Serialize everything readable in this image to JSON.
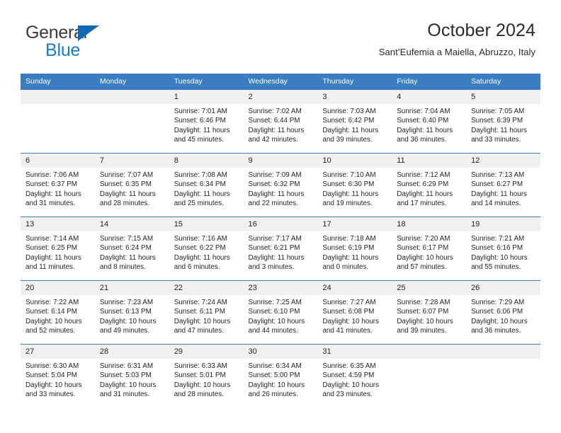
{
  "brand": {
    "name_top": "General",
    "name_bottom": "Blue",
    "accent_color": "#1a7dc4",
    "triangle_color": "#1268b3"
  },
  "header": {
    "title": "October 2024",
    "subtitle": "Sant’Eufemia a Maiella, Abruzzo, Italy"
  },
  "calendar": {
    "header_bg": "#3a7dc0",
    "daynum_bg": "#f0f0f0",
    "weekday_headers": [
      "Sunday",
      "Monday",
      "Tuesday",
      "Wednesday",
      "Thursday",
      "Friday",
      "Saturday"
    ],
    "labels": {
      "sunrise": "Sunrise:",
      "sunset": "Sunset:",
      "daylight": "Daylight:"
    },
    "weeks": [
      [
        {
          "day": "",
          "blank": true
        },
        {
          "day": "",
          "blank": true
        },
        {
          "day": "1",
          "sunrise": "Sunrise: 7:01 AM",
          "sunset": "Sunset: 6:46 PM",
          "daylight": "Daylight: 11 hours and 45 minutes."
        },
        {
          "day": "2",
          "sunrise": "Sunrise: 7:02 AM",
          "sunset": "Sunset: 6:44 PM",
          "daylight": "Daylight: 11 hours and 42 minutes."
        },
        {
          "day": "3",
          "sunrise": "Sunrise: 7:03 AM",
          "sunset": "Sunset: 6:42 PM",
          "daylight": "Daylight: 11 hours and 39 minutes."
        },
        {
          "day": "4",
          "sunrise": "Sunrise: 7:04 AM",
          "sunset": "Sunset: 6:40 PM",
          "daylight": "Daylight: 11 hours and 36 minutes."
        },
        {
          "day": "5",
          "sunrise": "Sunrise: 7:05 AM",
          "sunset": "Sunset: 6:39 PM",
          "daylight": "Daylight: 11 hours and 33 minutes."
        }
      ],
      [
        {
          "day": "6",
          "sunrise": "Sunrise: 7:06 AM",
          "sunset": "Sunset: 6:37 PM",
          "daylight": "Daylight: 11 hours and 31 minutes."
        },
        {
          "day": "7",
          "sunrise": "Sunrise: 7:07 AM",
          "sunset": "Sunset: 6:35 PM",
          "daylight": "Daylight: 11 hours and 28 minutes."
        },
        {
          "day": "8",
          "sunrise": "Sunrise: 7:08 AM",
          "sunset": "Sunset: 6:34 PM",
          "daylight": "Daylight: 11 hours and 25 minutes."
        },
        {
          "day": "9",
          "sunrise": "Sunrise: 7:09 AM",
          "sunset": "Sunset: 6:32 PM",
          "daylight": "Daylight: 11 hours and 22 minutes."
        },
        {
          "day": "10",
          "sunrise": "Sunrise: 7:10 AM",
          "sunset": "Sunset: 6:30 PM",
          "daylight": "Daylight: 11 hours and 19 minutes."
        },
        {
          "day": "11",
          "sunrise": "Sunrise: 7:12 AM",
          "sunset": "Sunset: 6:29 PM",
          "daylight": "Daylight: 11 hours and 17 minutes."
        },
        {
          "day": "12",
          "sunrise": "Sunrise: 7:13 AM",
          "sunset": "Sunset: 6:27 PM",
          "daylight": "Daylight: 11 hours and 14 minutes."
        }
      ],
      [
        {
          "day": "13",
          "sunrise": "Sunrise: 7:14 AM",
          "sunset": "Sunset: 6:25 PM",
          "daylight": "Daylight: 11 hours and 11 minutes."
        },
        {
          "day": "14",
          "sunrise": "Sunrise: 7:15 AM",
          "sunset": "Sunset: 6:24 PM",
          "daylight": "Daylight: 11 hours and 8 minutes."
        },
        {
          "day": "15",
          "sunrise": "Sunrise: 7:16 AM",
          "sunset": "Sunset: 6:22 PM",
          "daylight": "Daylight: 11 hours and 6 minutes."
        },
        {
          "day": "16",
          "sunrise": "Sunrise: 7:17 AM",
          "sunset": "Sunset: 6:21 PM",
          "daylight": "Daylight: 11 hours and 3 minutes."
        },
        {
          "day": "17",
          "sunrise": "Sunrise: 7:18 AM",
          "sunset": "Sunset: 6:19 PM",
          "daylight": "Daylight: 11 hours and 0 minutes."
        },
        {
          "day": "18",
          "sunrise": "Sunrise: 7:20 AM",
          "sunset": "Sunset: 6:17 PM",
          "daylight": "Daylight: 10 hours and 57 minutes."
        },
        {
          "day": "19",
          "sunrise": "Sunrise: 7:21 AM",
          "sunset": "Sunset: 6:16 PM",
          "daylight": "Daylight: 10 hours and 55 minutes."
        }
      ],
      [
        {
          "day": "20",
          "sunrise": "Sunrise: 7:22 AM",
          "sunset": "Sunset: 6:14 PM",
          "daylight": "Daylight: 10 hours and 52 minutes."
        },
        {
          "day": "21",
          "sunrise": "Sunrise: 7:23 AM",
          "sunset": "Sunset: 6:13 PM",
          "daylight": "Daylight: 10 hours and 49 minutes."
        },
        {
          "day": "22",
          "sunrise": "Sunrise: 7:24 AM",
          "sunset": "Sunset: 6:11 PM",
          "daylight": "Daylight: 10 hours and 47 minutes."
        },
        {
          "day": "23",
          "sunrise": "Sunrise: 7:25 AM",
          "sunset": "Sunset: 6:10 PM",
          "daylight": "Daylight: 10 hours and 44 minutes."
        },
        {
          "day": "24",
          "sunrise": "Sunrise: 7:27 AM",
          "sunset": "Sunset: 6:08 PM",
          "daylight": "Daylight: 10 hours and 41 minutes."
        },
        {
          "day": "25",
          "sunrise": "Sunrise: 7:28 AM",
          "sunset": "Sunset: 6:07 PM",
          "daylight": "Daylight: 10 hours and 39 minutes."
        },
        {
          "day": "26",
          "sunrise": "Sunrise: 7:29 AM",
          "sunset": "Sunset: 6:06 PM",
          "daylight": "Daylight: 10 hours and 36 minutes."
        }
      ],
      [
        {
          "day": "27",
          "sunrise": "Sunrise: 6:30 AM",
          "sunset": "Sunset: 5:04 PM",
          "daylight": "Daylight: 10 hours and 33 minutes."
        },
        {
          "day": "28",
          "sunrise": "Sunrise: 6:31 AM",
          "sunset": "Sunset: 5:03 PM",
          "daylight": "Daylight: 10 hours and 31 minutes."
        },
        {
          "day": "29",
          "sunrise": "Sunrise: 6:33 AM",
          "sunset": "Sunset: 5:01 PM",
          "daylight": "Daylight: 10 hours and 28 minutes."
        },
        {
          "day": "30",
          "sunrise": "Sunrise: 6:34 AM",
          "sunset": "Sunset: 5:00 PM",
          "daylight": "Daylight: 10 hours and 26 minutes."
        },
        {
          "day": "31",
          "sunrise": "Sunrise: 6:35 AM",
          "sunset": "Sunset: 4:59 PM",
          "daylight": "Daylight: 10 hours and 23 minutes."
        },
        {
          "day": "",
          "blank": true
        },
        {
          "day": "",
          "blank": true
        }
      ]
    ]
  }
}
